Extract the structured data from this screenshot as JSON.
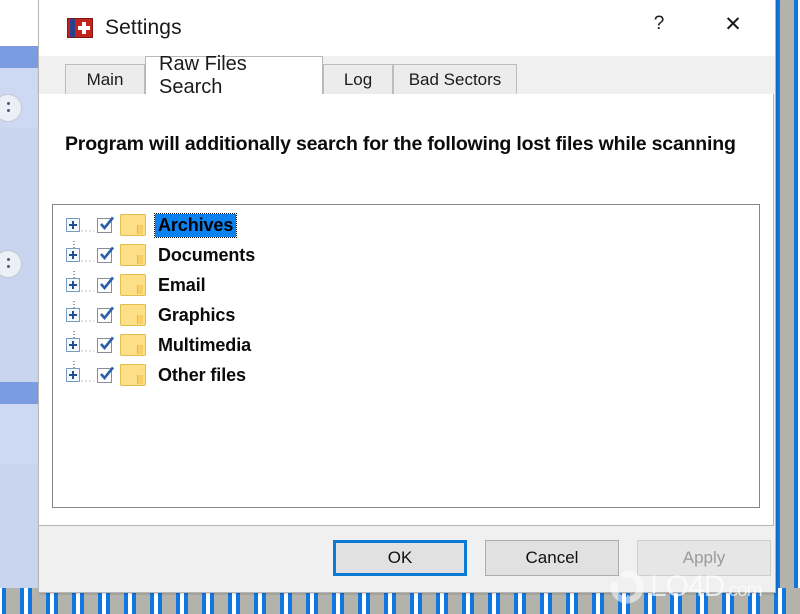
{
  "window": {
    "title": "Settings",
    "icon": "first-aid-cross-icon",
    "help_label": "?",
    "close_label": "✕"
  },
  "tabs": [
    {
      "label": "Main",
      "active": false
    },
    {
      "label": "Raw Files Search",
      "active": true
    },
    {
      "label": "Log",
      "active": false
    },
    {
      "label": "Bad Sectors",
      "active": false
    }
  ],
  "panel": {
    "heading": "Program will additionally search for the following lost files while scanning",
    "tree": [
      {
        "label": "Archives",
        "checked": true,
        "expandable": true,
        "selected": true
      },
      {
        "label": "Documents",
        "checked": true,
        "expandable": true,
        "selected": false
      },
      {
        "label": "Email",
        "checked": true,
        "expandable": true,
        "selected": false
      },
      {
        "label": "Graphics",
        "checked": true,
        "expandable": true,
        "selected": false
      },
      {
        "label": "Multimedia",
        "checked": true,
        "expandable": true,
        "selected": false
      },
      {
        "label": "Other files",
        "checked": true,
        "expandable": true,
        "selected": false
      }
    ]
  },
  "footer": {
    "ok_label": "OK",
    "cancel_label": "Cancel",
    "apply_label": "Apply"
  },
  "watermark": {
    "text": "LO4D",
    "suffix": ".com"
  },
  "colors": {
    "accent": "#0d7bd4",
    "selection": "#0b82f0",
    "folder": "#fcdf86",
    "dialog_bg": "#f0f0f0",
    "panel_bg": "#ffffff",
    "desktop_tile_blue": "#1177e0"
  }
}
